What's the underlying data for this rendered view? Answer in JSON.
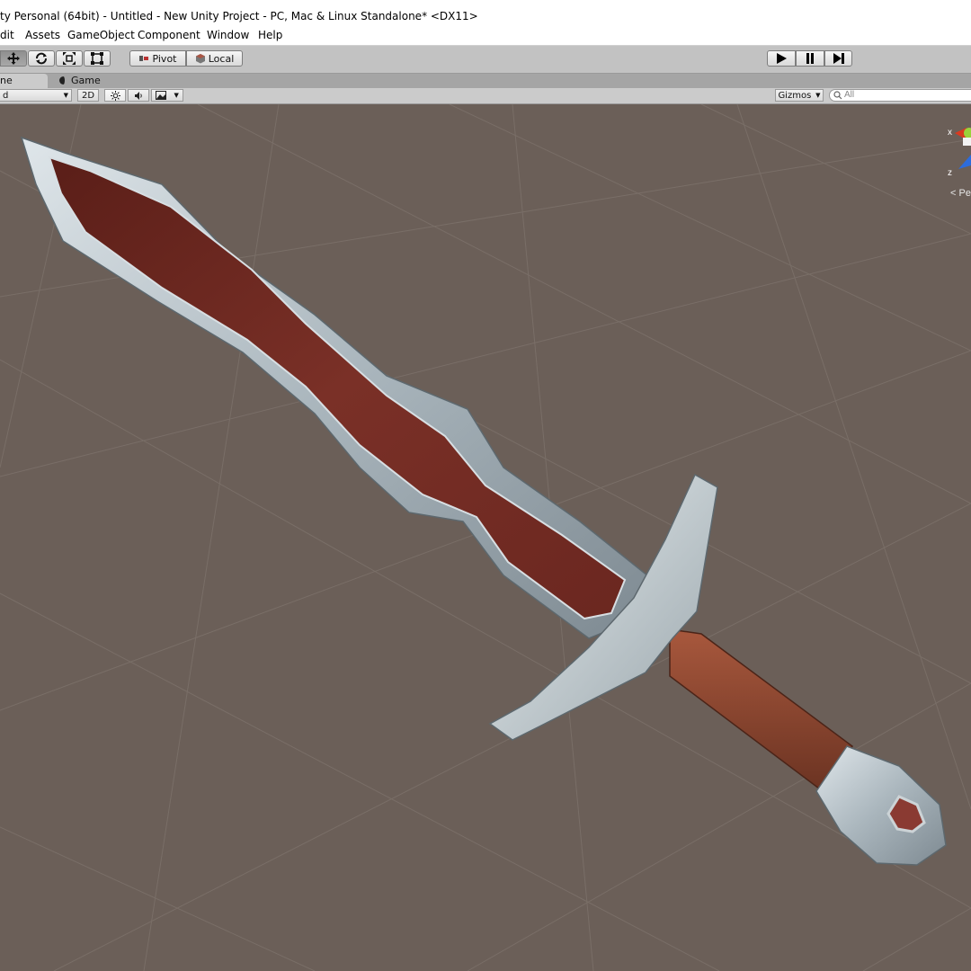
{
  "window": {
    "title": "ty Personal (64bit) - Untitled - New Unity Project - PC, Mac & Linux Standalone* <DX11>"
  },
  "menubar": {
    "items": [
      "dit",
      "Assets",
      "GameObject",
      "Component",
      "Window",
      "Help"
    ]
  },
  "toolbar": {
    "pivot_label": "Pivot",
    "local_label": "Local"
  },
  "tabs": {
    "scene_label": "ne",
    "game_label": "Game"
  },
  "scene_toolbar": {
    "shading_value": "d",
    "mode_2d_label": "2D",
    "gizmos_label": "Gizmos",
    "search_placeholder": "All"
  },
  "gizmo": {
    "x_label": "x",
    "z_label": "z",
    "persp_label": "Pe"
  },
  "colors": {
    "viewport_bg": "#6b5f58",
    "toolbar_bg": "#c2c2c2",
    "blade_steel": "#b9c3c9",
    "blade_inlay": "#6f2a22",
    "handle_wood": "#8b4a33"
  },
  "icons": [
    "move-icon",
    "rotate-icon",
    "scale-icon",
    "rect-tool-icon",
    "play-icon",
    "pause-icon",
    "step-icon",
    "light-icon",
    "audio-icon",
    "effects-icon",
    "search-icon"
  ]
}
